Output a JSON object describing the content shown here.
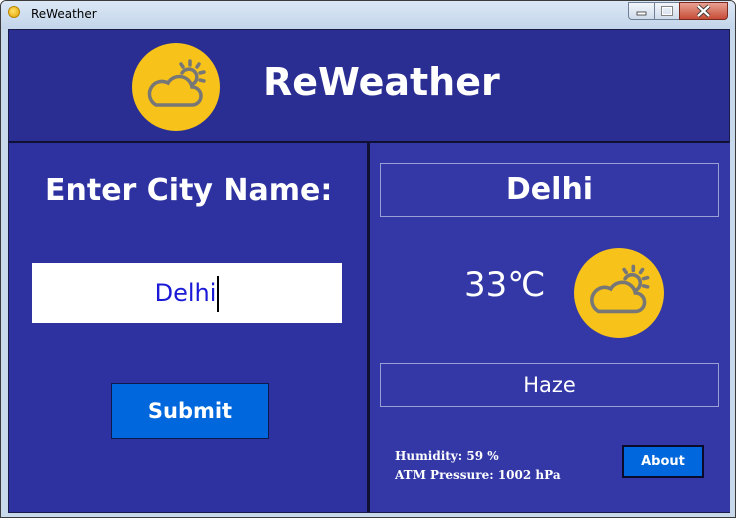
{
  "window": {
    "title": "ReWeather"
  },
  "header": {
    "app_title": "ReWeather",
    "icon": "partly-cloudy-icon"
  },
  "search": {
    "label": "Enter City Name:",
    "value": "Delhi",
    "submit_label": "Submit"
  },
  "result": {
    "city": "Delhi",
    "temperature": "33℃",
    "weather_icon": "partly-cloudy-icon",
    "condition": "Haze",
    "humidity": "Humidity: 59 %",
    "pressure": "ATM Pressure: 1002 hPa",
    "about_label": "About"
  },
  "colors": {
    "background": "#2e32a0",
    "accent": "#0067dd",
    "icon_circle": "#f7c21a",
    "input_text": "#1a1ad6"
  }
}
